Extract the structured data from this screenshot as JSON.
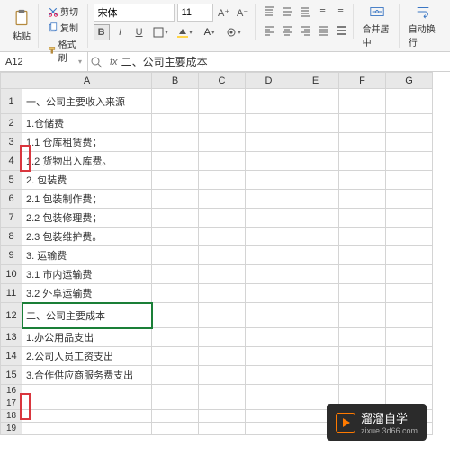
{
  "ribbon": {
    "paste_label": "粘贴",
    "cut_label": "剪切",
    "copy_label": "复制",
    "format_painter_label": "格式刷",
    "merge_center_label": "合并居中",
    "auto_wrap_label": "自动换行",
    "font_name": "宋体",
    "font_size": "11"
  },
  "namebox": "A12",
  "formula": "二、公司主要成本",
  "columns": [
    "A",
    "B",
    "C",
    "D",
    "E",
    "F",
    "G"
  ],
  "rows": [
    {
      "n": 1,
      "a": "一、公司主要收入来源",
      "bold": true
    },
    {
      "n": 2,
      "a": "1.仓储费"
    },
    {
      "n": 3,
      "a": "1.1 仓库租赁费；"
    },
    {
      "n": 4,
      "a": "1.2 货物出入库费。"
    },
    {
      "n": 5,
      "a": "2. 包装费"
    },
    {
      "n": 6,
      "a": "2.1 包装制作费；"
    },
    {
      "n": 7,
      "a": "2.2 包装修理费；"
    },
    {
      "n": 8,
      "a": "2.3 包装维护费。"
    },
    {
      "n": 9,
      "a": "3. 运输费"
    },
    {
      "n": 10,
      "a": "3.1 市内运输费"
    },
    {
      "n": 11,
      "a": "3.2 外阜运输费"
    },
    {
      "n": 12,
      "a": "二、公司主要成本",
      "bold": true,
      "selected": true
    },
    {
      "n": 13,
      "a": "1.办公用品支出"
    },
    {
      "n": 14,
      "a": "2.公司人员工资支出"
    },
    {
      "n": 15,
      "a": "3.合作供应商服务费支出"
    },
    {
      "n": 16,
      "a": "",
      "small": true
    },
    {
      "n": 17,
      "a": "",
      "small": true
    },
    {
      "n": 18,
      "a": "",
      "small": true
    },
    {
      "n": 19,
      "a": "",
      "small": true
    }
  ],
  "watermark": {
    "brand": "溜溜自学",
    "url": "zixue.3d66.com"
  }
}
